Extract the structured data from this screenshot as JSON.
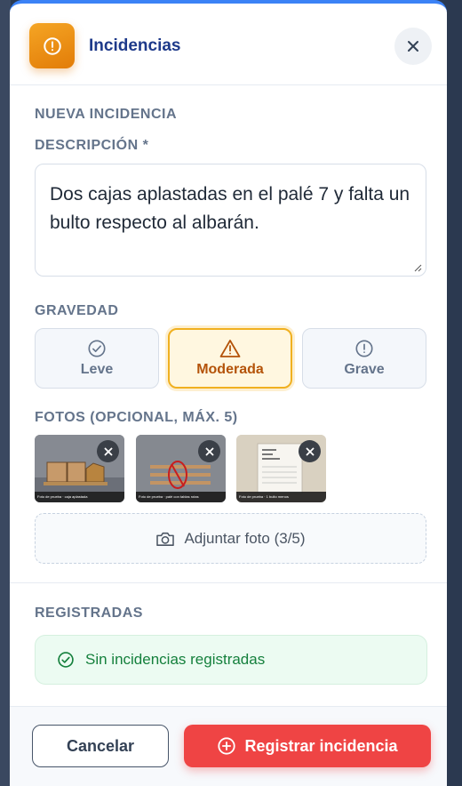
{
  "header": {
    "title": "Incidencias",
    "app_icon": "alert-circle-icon",
    "close_icon": "close-icon"
  },
  "form": {
    "section_title": "NUEVA INCIDENCIA",
    "description_label": "DESCRIPCIÓN *",
    "description_value": "Dos cajas aplastadas en el palé 7 y falta un bulto respecto al albarán.",
    "severity_label": "GRAVEDAD",
    "severity_options": [
      {
        "label": "Leve",
        "icon": "check-circle-icon",
        "selected": false
      },
      {
        "label": "Moderada",
        "icon": "warning-triangle-icon",
        "selected": true
      },
      {
        "label": "Grave",
        "icon": "alert-circle-icon",
        "selected": false
      }
    ],
    "photos_label": "FOTOS (OPCIONAL, MÁX. 5)",
    "photos": [
      {
        "caption": "Foto de prueba · caja aplastada"
      },
      {
        "caption": "Foto de prueba · palé con tablas rotas"
      },
      {
        "caption": "Foto de prueba · 1 bulto menos"
      }
    ],
    "attach_label": "Adjuntar foto (3/5)"
  },
  "registered": {
    "label": "REGISTRADAS",
    "empty_text": "Sin incidencias registradas"
  },
  "footer": {
    "cancel_label": "Cancelar",
    "submit_label": "Registrar incidencia"
  },
  "colors": {
    "accent_orange": "#e27c08",
    "title_blue": "#1e3a8a",
    "danger": "#ef4444",
    "success": "#15803d"
  }
}
